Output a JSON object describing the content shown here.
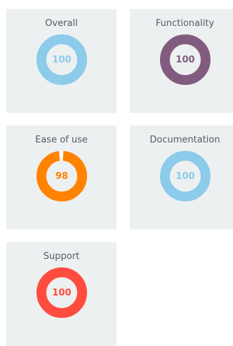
{
  "scores": [
    {
      "title": "Overall",
      "value": 100,
      "color": "#8ccbe9"
    },
    {
      "title": "Functionality",
      "value": 100,
      "color": "#825c7e"
    },
    {
      "title": "Ease of use",
      "value": 98,
      "color": "#ff8200"
    },
    {
      "title": "Documentation",
      "value": 100,
      "color": "#8ccbe9"
    },
    {
      "title": "Support",
      "value": 100,
      "color": "#ff4c3e"
    }
  ]
}
